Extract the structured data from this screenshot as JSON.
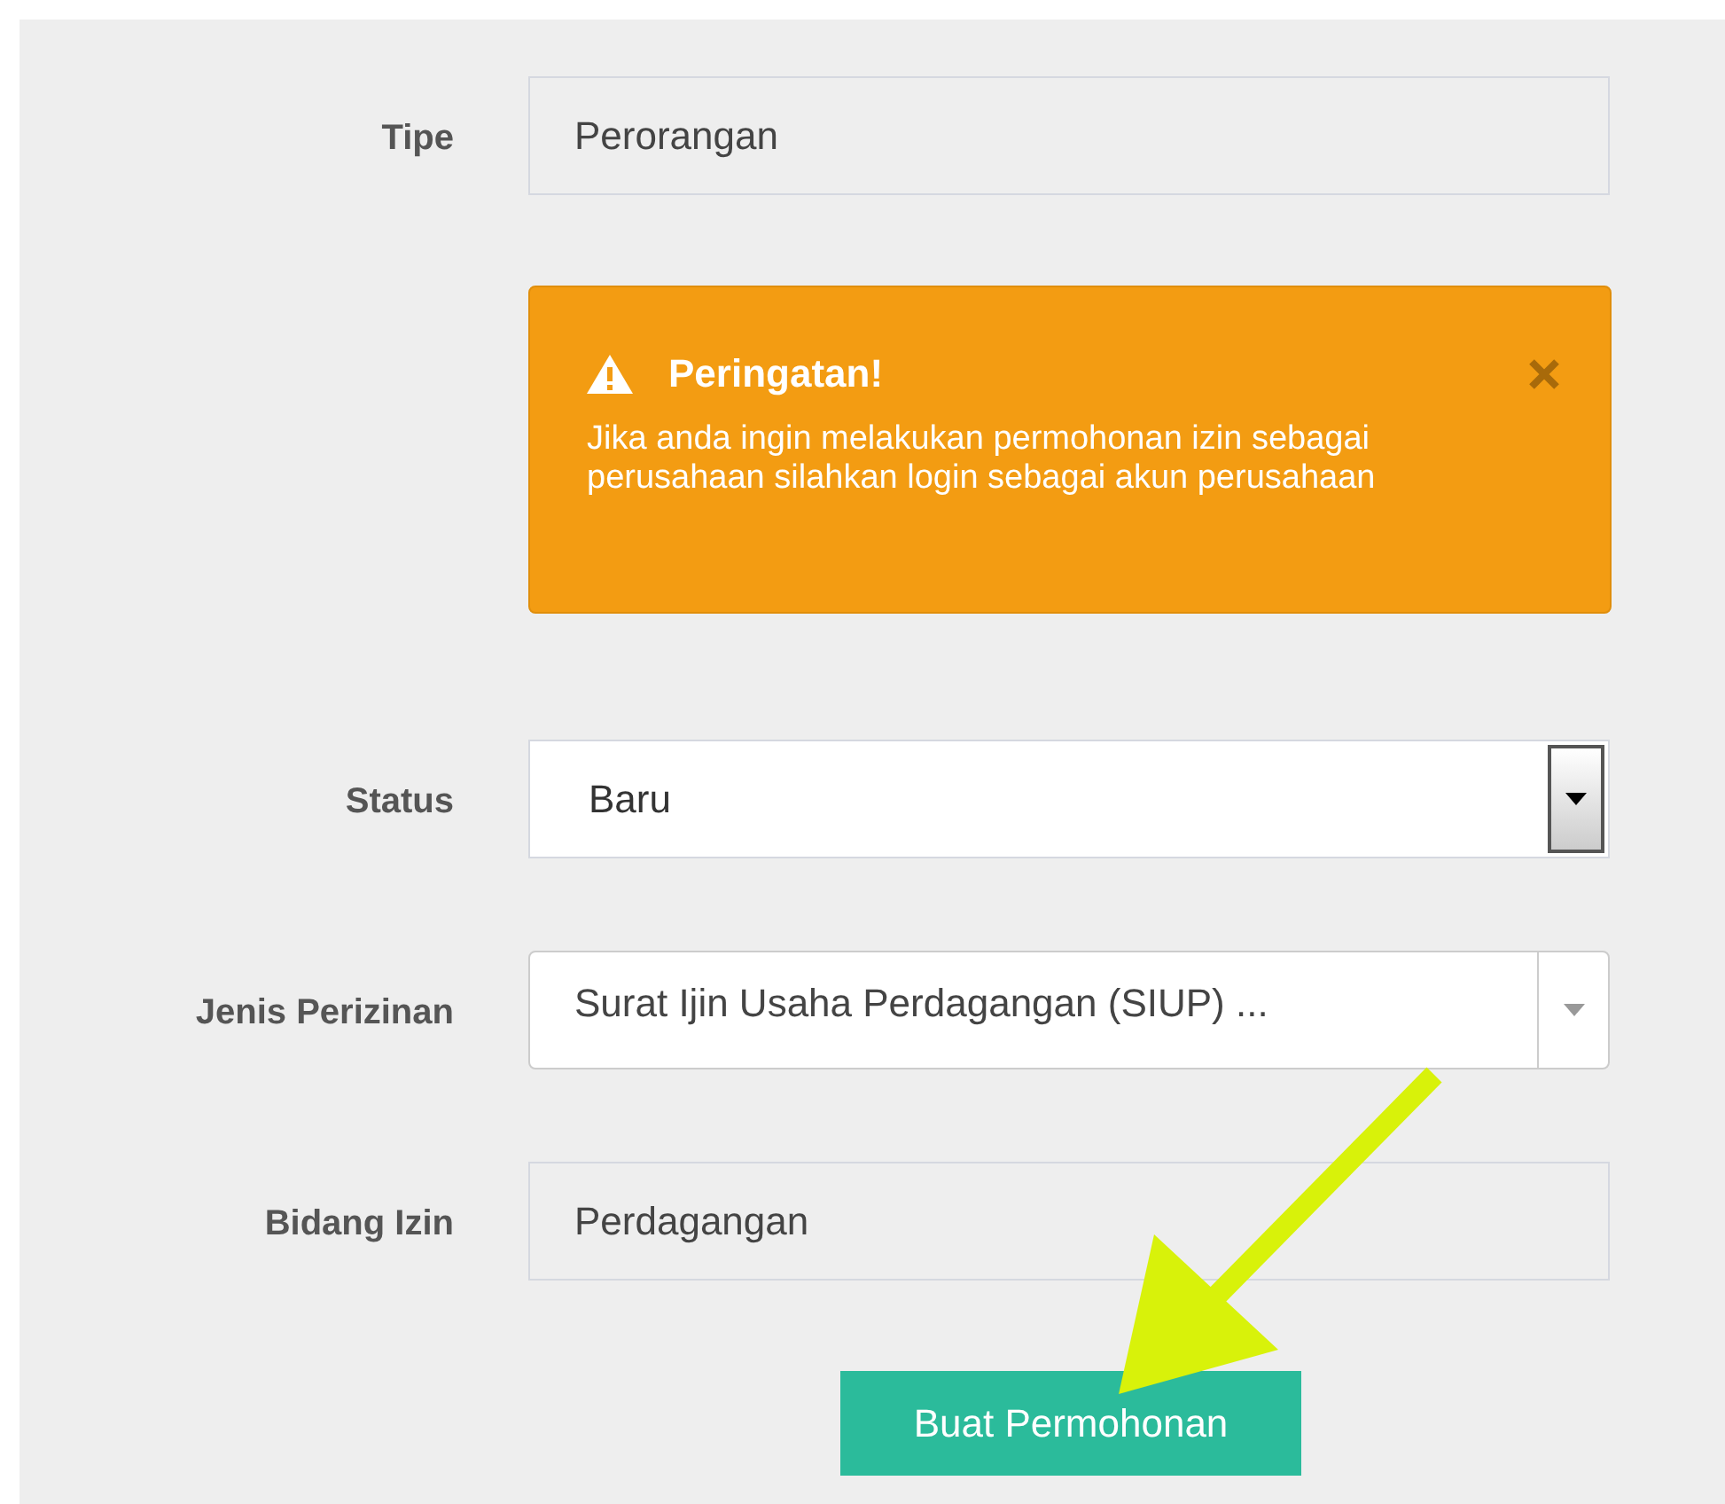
{
  "form": {
    "rows": [
      {
        "kind": "readonly",
        "label": "Tipe",
        "value": "Perorangan"
      },
      {
        "kind": "alert",
        "title": "Peringatan!",
        "message": "Jika anda ingin melakukan permohonan izin sebagai perusahaan silahkan login sebagai akun perusahaan"
      },
      {
        "kind": "select",
        "label": "Status",
        "value": "Baru"
      },
      {
        "kind": "combo",
        "label": "Jenis Perizinan",
        "value": "Surat Ijin Usaha Perdagangan (SIUP) ..."
      },
      {
        "kind": "readonly",
        "label": "Bidang Izin",
        "value": "Perdagangan"
      }
    ],
    "submit": {
      "label": "Buat Permohonan"
    }
  }
}
